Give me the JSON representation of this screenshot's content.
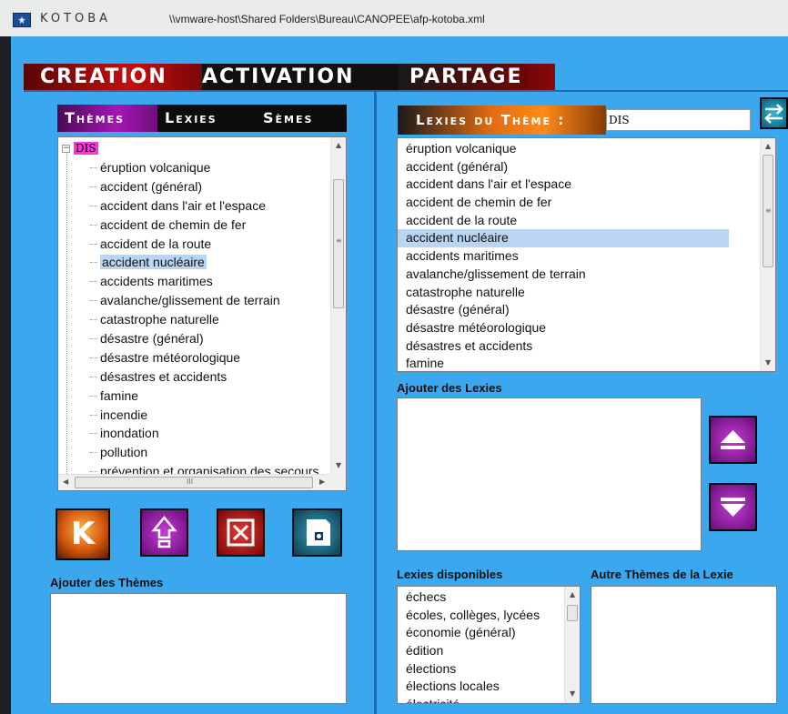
{
  "window": {
    "app_title": "KOTOBA",
    "file_path": "\\\\vmware-host\\Shared Folders\\Bureau\\CANOPEE\\afp-kotoba.xml"
  },
  "menu": {
    "items": [
      "CREATION",
      "ACTIVATION",
      "PARTAGE"
    ],
    "active": "CREATION"
  },
  "left_tabs": {
    "items": [
      "Thèmes",
      "Lexies",
      "Sèmes"
    ],
    "active": "Thèmes"
  },
  "tree": {
    "root": "DIS",
    "items": [
      "éruption volcanique",
      "accident (général)",
      "accident dans l'air et l'espace",
      "accident de chemin de fer",
      "accident de la route",
      "accident nucléaire",
      "accidents maritimes",
      "avalanche/glissement de terrain",
      "catastrophe naturelle",
      "désastre (général)",
      "désastre météorologique",
      "désastres et accidents",
      "famine",
      "incendie",
      "inondation",
      "pollution",
      "prévention et organisation des secours"
    ],
    "selected_index": 5,
    "toggle_glyph": "−",
    "grip_glyph": "≡",
    "hgrip_glyph": "III"
  },
  "buttons": {
    "k_label": "K",
    "up_icon": "upload-icon",
    "delete_icon": "delete-icon",
    "save_icon": "save-icon",
    "swap_icon": "swap-icon"
  },
  "left_bottom": {
    "add_themes_label": "Ajouter des Thèmes",
    "add_themes_value": ""
  },
  "right": {
    "header_label": "Lexies du Thème :",
    "theme_value": "DIS",
    "lexies": [
      "éruption volcanique",
      "accident (général)",
      "accident dans l'air et l'espace",
      "accident de chemin de fer",
      "accident de la route",
      "accident nucléaire",
      "accidents maritimes",
      "avalanche/glissement de terrain",
      "catastrophe naturelle",
      "désastre (général)",
      "désastre météorologique",
      "désastres et accidents",
      "famine"
    ],
    "selected_index": 5,
    "add_lexies_label": "Ajouter des Lexies",
    "add_lexies_value": "",
    "available_label": "Lexies disponibles",
    "other_themes_label": "Autre Thèmes de la Lexie",
    "available": [
      "échecs",
      "écoles, collèges, lycées",
      "économie (général)",
      "édition",
      "élections",
      "élections locales",
      "électricité"
    ]
  },
  "colors": {
    "background": "#3ba7ee",
    "selection": "#b9d5f2",
    "root_highlight": "#ff33d9",
    "active_menu": "#c21010",
    "active_tab": "#a516b4",
    "header_orange": "#ff8a17"
  }
}
